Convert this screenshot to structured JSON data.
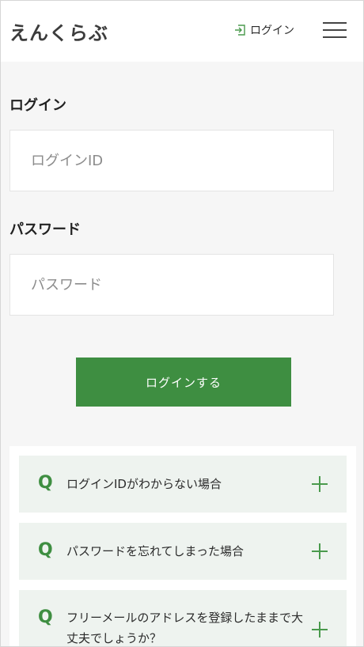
{
  "header": {
    "logo": "えんくらぶ",
    "login_label": "ログイン",
    "icons": {
      "login": "login-icon",
      "menu": "hamburger-menu-icon"
    }
  },
  "form": {
    "login_id_label": "ログイン",
    "login_id_placeholder": "ログインID",
    "login_id_value": "",
    "password_label": "パスワード",
    "password_placeholder": "パスワード",
    "password_value": "",
    "submit_label": "ログインする"
  },
  "faq": {
    "items": [
      {
        "q": "Q",
        "text": "ログインIDがわからない場合"
      },
      {
        "q": "Q",
        "text": "パスワードを忘れてしまった場合"
      },
      {
        "q": "Q",
        "text": "フリーメールのアドレスを登録したままで大丈夫でしょうか？"
      }
    ]
  },
  "colors": {
    "accent": "#3e8e41",
    "faq_background": "#eef3ef",
    "page_background": "#f6f6f6"
  }
}
